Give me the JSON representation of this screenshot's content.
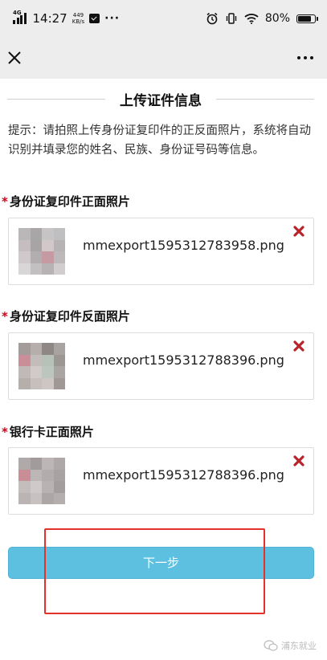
{
  "status_bar": {
    "network": "4G",
    "time": "14:27",
    "speed_value": "449",
    "speed_unit": "KB/s",
    "dots": "···",
    "battery": "80%"
  },
  "nav": {
    "close_icon": "close-icon",
    "more_icon": "more-icon"
  },
  "title": "上传证件信息",
  "hint": "提示：请拍照上传身份证复印件的正反面照片，系统将自动识别并填录您的姓名、民族、身份证号码等信息。",
  "fields": [
    {
      "required": "*",
      "label": "身份证复印件正面照片",
      "file": "mmexport1595312783958.png"
    },
    {
      "required": "*",
      "label": "身份证复印件反面照片",
      "file": "mmexport1595312788396.png"
    },
    {
      "required": "*",
      "label": "银行卡正面照片",
      "file": "mmexport1595312788396.png"
    }
  ],
  "next_button": "下一步",
  "watermark": "浦东就业",
  "colors": {
    "button": "#5ec0e0",
    "required": "#d0021b",
    "remove": "#b8242c",
    "highlight": "#e5312c"
  }
}
